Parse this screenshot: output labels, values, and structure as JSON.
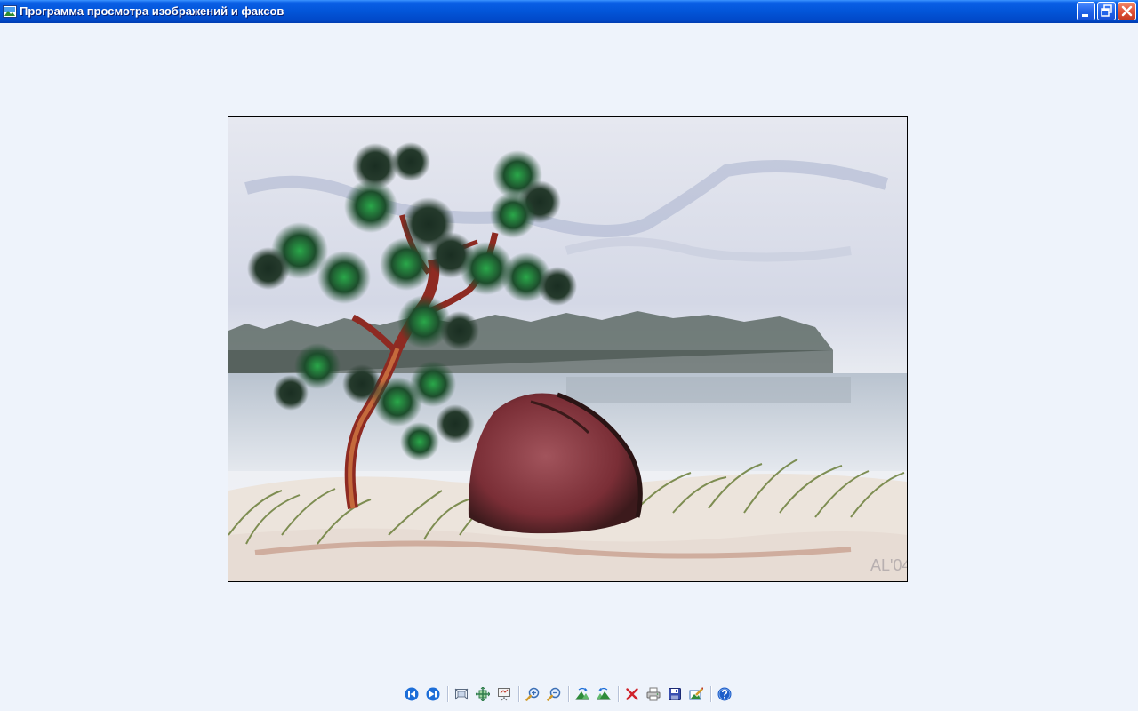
{
  "window": {
    "title": "Программа просмотра изображений и факсов"
  },
  "image": {
    "signature": "AL'04"
  },
  "toolbar": {
    "buttons": [
      {
        "icon": "previous-image-icon"
      },
      {
        "icon": "next-image-icon"
      },
      {
        "icon": "best-fit-icon"
      },
      {
        "icon": "actual-size-icon"
      },
      {
        "icon": "slideshow-icon"
      },
      {
        "icon": "zoom-in-icon"
      },
      {
        "icon": "zoom-out-icon"
      },
      {
        "icon": "rotate-clockwise-icon"
      },
      {
        "icon": "rotate-counterclockwise-icon"
      },
      {
        "icon": "delete-icon"
      },
      {
        "icon": "print-icon"
      },
      {
        "icon": "save-icon"
      },
      {
        "icon": "edit-icon"
      },
      {
        "icon": "help-icon"
      }
    ]
  },
  "colors": {
    "titlebar": "#0255d8",
    "background": "#eef3fb",
    "close_button": "#e2543a"
  }
}
